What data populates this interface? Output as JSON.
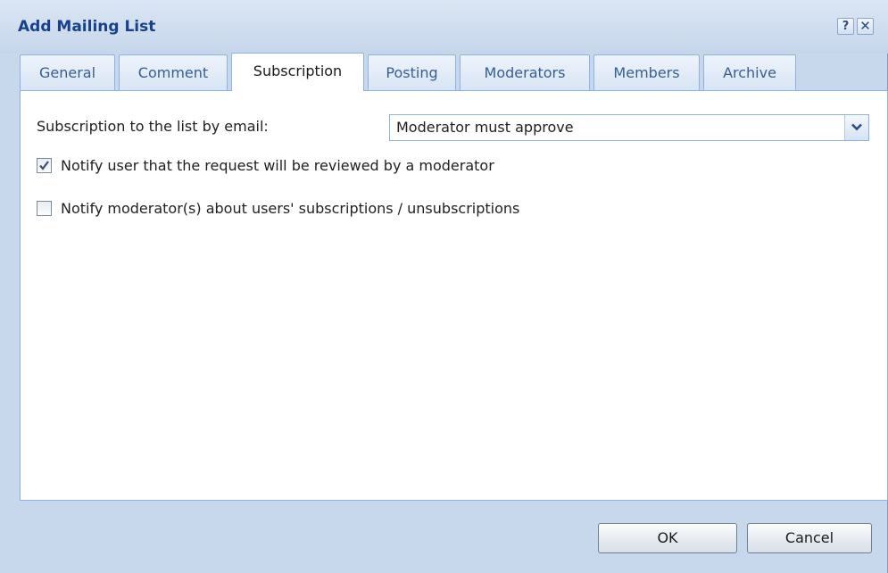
{
  "dialog": {
    "title": "Add Mailing List",
    "help_glyph": "?",
    "close_glyph": "✕"
  },
  "tabs": [
    {
      "label": "General",
      "active": false
    },
    {
      "label": "Comment",
      "active": false
    },
    {
      "label": "Subscription",
      "active": true
    },
    {
      "label": "Posting",
      "active": false
    },
    {
      "label": "Moderators",
      "active": false
    },
    {
      "label": "Members",
      "active": false
    },
    {
      "label": "Archive",
      "active": false
    }
  ],
  "subscription": {
    "field_label": "Subscription to the list by email:",
    "selected_value": "Moderator must approve",
    "notify_user_label": "Notify user that the request will be reviewed by a moderator",
    "notify_user_checked": true,
    "notify_moderators_label": "Notify moderator(s) about users' subscriptions / unsubscriptions",
    "notify_moderators_checked": false
  },
  "buttons": {
    "ok_label": "OK",
    "cancel_label": "Cancel"
  },
  "colors": {
    "frame_background": "#c8d8ec",
    "title_text": "#15428b",
    "tab_border": "#8db2e3"
  },
  "icons": {
    "help": "help-icon",
    "close": "close-icon",
    "dropdown": "chevron-down-icon",
    "check": "checkmark-icon"
  }
}
